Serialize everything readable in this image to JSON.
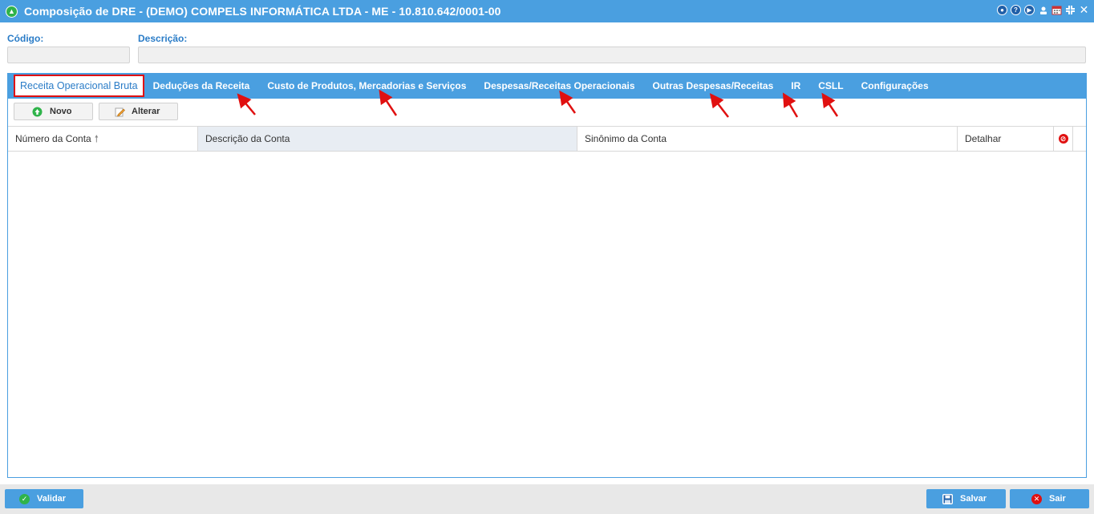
{
  "window": {
    "title": "Composição de DRE - (DEMO) COMPELS INFORMÁTICA LTDA - ME - 10.810.642/0001-00",
    "tools": [
      "eye-icon",
      "help-icon",
      "play-icon",
      "user-icon",
      "calendar-icon",
      "minimize-icon",
      "close-icon"
    ]
  },
  "form": {
    "codigo_label": "Código:",
    "codigo_value": "",
    "descricao_label": "Descrição:",
    "descricao_value": ""
  },
  "tabs": [
    {
      "label": "Receita Operacional Bruta",
      "active": true
    },
    {
      "label": "Deduções da Receita",
      "active": false
    },
    {
      "label": "Custo de Produtos, Mercadorias e Serviços",
      "active": false
    },
    {
      "label": "Despesas/Receitas Operacionais",
      "active": false
    },
    {
      "label": "Outras Despesas/Receitas",
      "active": false
    },
    {
      "label": "IR",
      "active": false
    },
    {
      "label": "CSLL",
      "active": false
    },
    {
      "label": "Configurações",
      "active": false
    }
  ],
  "toolbar": {
    "novo_label": "Novo",
    "alterar_label": "Alterar"
  },
  "grid": {
    "columns": [
      {
        "label": "Número da Conta",
        "sorted": "asc"
      },
      {
        "label": "Descrição da Conta"
      },
      {
        "label": "Sinônimo da Conta"
      },
      {
        "label": "Detalhar"
      }
    ],
    "rows": []
  },
  "footer": {
    "validar_label": "Validar",
    "salvar_label": "Salvar",
    "sair_label": "Sair"
  },
  "colors": {
    "accent": "#4a9fe0",
    "highlight": "#e01010"
  }
}
